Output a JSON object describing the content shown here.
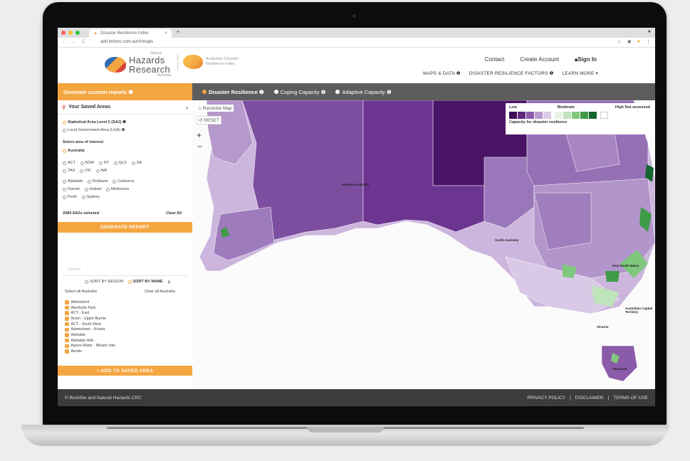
{
  "browser": {
    "tab_title": "Disaster Resilience Index",
    "tab_close": "×",
    "new_tab": "+",
    "url": "adri.bnhcrc.com.au/#!/maps",
    "nav_icons": [
      "←",
      "→",
      "C"
    ],
    "ext_icons": [
      "☆",
      "✱",
      "●",
      "⋮"
    ],
    "colors": {
      "close": "#fc5f57",
      "min": "#fdbc2e",
      "max": "#28c840"
    }
  },
  "header": {
    "logo1_small": "Natural",
    "logo1_line1": "Hazards",
    "logo1_line2": "Research",
    "logo1_sub": "Australia",
    "logo2_text": "Australian Disaster Resilience Index",
    "links": {
      "contact": "Contact",
      "create_account": "Create Account",
      "sign_in": "Sign In"
    },
    "nav": {
      "maps_data": "MAPS & DATA ❶",
      "factors": "DISASTER RESILIENCE FACTORS ❶",
      "learn_more": "LEARN MORE ▾"
    }
  },
  "toolbar": {
    "generate_custom": "Generate custom reports ❶",
    "tabs": [
      {
        "label": "Disaster Resilience ❶"
      },
      {
        "label": "Coping Capacity ❶"
      },
      {
        "label": "Adaptive Capacity ❶"
      }
    ]
  },
  "sidebar": {
    "saved_areas": "Your Saved Areas",
    "chevron": "›",
    "level_options": [
      "Statistical Area Level 2 (SA2) ❶",
      "Local Government Area (LGA) ❶"
    ],
    "select_area_label": "Select area of interest",
    "australia": "Australia",
    "states_row1": [
      "ACT",
      "NSW",
      "NT",
      "QLD",
      "SA"
    ],
    "states_row2": [
      "TAS",
      "VIC",
      "WA"
    ],
    "cities_row1": [
      "Adelaide",
      "Brisbane",
      "Canberra"
    ],
    "cities_row2": [
      "Darwin",
      "Hobart",
      "Melbourne"
    ],
    "cities_row3": [
      "Perth",
      "Sydney"
    ],
    "selected_count": "2084 SA2s selected",
    "clear_all": "Clear All",
    "generate_report": "GENERATE REPORT",
    "search_placeholder": "Search",
    "sort_region": "SORT BY REGION",
    "sort_name": "SORT BY NAME",
    "sort_icon": "⇅",
    "select_all": "Select all Australia",
    "clear_all_aus": "Clear all Australia",
    "areas": [
      "Abbotsford",
      "Aberfoyle Park",
      "ACT - East",
      "Acton - Upper Burnie",
      "ACT - South West",
      "Adamstown - Kotara",
      "Adelaide",
      "Adelaide Hills",
      "Agnes Water - Miriam Vale",
      "Ainslie"
    ],
    "add_saved": "+ ADD TO SAVED AREA"
  },
  "map": {
    "recentre": "◇ Recentre Map",
    "reset": "↺ RESET",
    "zoom_in": "+",
    "zoom_out": "−",
    "legend": {
      "low": "Low",
      "moderate": "Moderate",
      "high": "High",
      "not_assessed": "Not assessed",
      "caption": "Capacity for disaster resilience",
      "colors": [
        "#3f0f57",
        "#5e2a7e",
        "#8a5ba8",
        "#b89bcf",
        "#dccbe8",
        "#e9f3e6",
        "#bfe3bb",
        "#80c77e",
        "#3f9b47",
        "#13662c",
        "#ffffff"
      ]
    },
    "labels": {
      "western_australia": "Western Australia",
      "south_australia": "South Australia",
      "new_south_wales": "New South Wales",
      "act": "Australian Capital Territory",
      "victoria": "Victoria",
      "tasmania": "Tasmania"
    }
  },
  "footer": {
    "copyright": "© Bushfire and Natural Hazards CRC",
    "privacy": "PRIVACY POLICY",
    "disclaimer": "DISCLAIMER",
    "terms": "TERMS OF USE",
    "sep": "|"
  }
}
